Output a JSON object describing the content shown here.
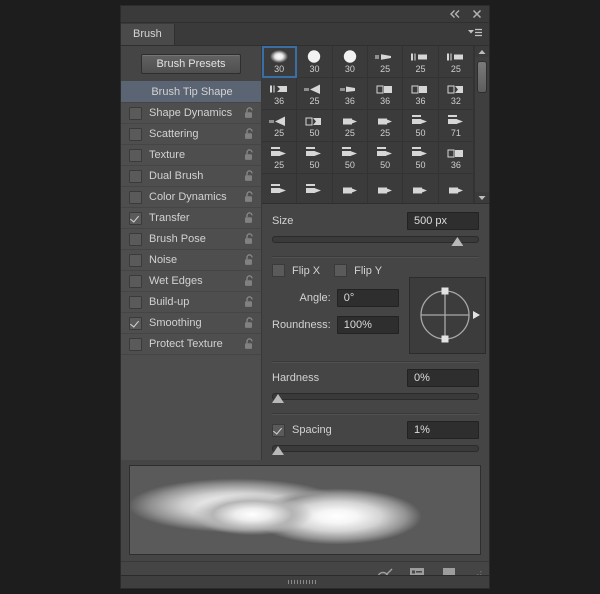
{
  "window": {
    "collapse_icon": "collapse-double-chevron-icon",
    "close_icon": "close-icon",
    "menu_icon": "panel-menu-icon"
  },
  "tabs": [
    {
      "label": "Brush",
      "active": true
    }
  ],
  "sidebar": {
    "presets_button": "Brush Presets",
    "items": [
      {
        "label": "Brush Tip Shape",
        "header": true,
        "checked": false,
        "locked": false
      },
      {
        "label": "Shape Dynamics",
        "header": false,
        "checked": false,
        "locked": true
      },
      {
        "label": "Scattering",
        "header": false,
        "checked": false,
        "locked": true
      },
      {
        "label": "Texture",
        "header": false,
        "checked": false,
        "locked": true
      },
      {
        "label": "Dual Brush",
        "header": false,
        "checked": false,
        "locked": true
      },
      {
        "label": "Color Dynamics",
        "header": false,
        "checked": false,
        "locked": true
      },
      {
        "label": "Transfer",
        "header": false,
        "checked": true,
        "locked": true
      },
      {
        "label": "Brush Pose",
        "header": false,
        "checked": false,
        "locked": true
      },
      {
        "label": "Noise",
        "header": false,
        "checked": false,
        "locked": true
      },
      {
        "label": "Wet Edges",
        "header": false,
        "checked": false,
        "locked": true
      },
      {
        "label": "Build-up",
        "header": false,
        "checked": false,
        "locked": true
      },
      {
        "label": "Smoothing",
        "header": false,
        "checked": true,
        "locked": true
      },
      {
        "label": "Protect Texture",
        "header": false,
        "checked": false,
        "locked": true
      }
    ]
  },
  "brush_grid": {
    "selected_index": 0,
    "scroll_up_icon": "scroll-up-arrow-icon",
    "scroll_down_icon": "scroll-down-arrow-icon",
    "cells": [
      {
        "size": "30",
        "tip": "soft-round"
      },
      {
        "size": "30",
        "tip": "hard-round"
      },
      {
        "size": "30",
        "tip": "hard-round"
      },
      {
        "size": "25",
        "tip": "flat-tip"
      },
      {
        "size": "25",
        "tip": "bristle-flat"
      },
      {
        "size": "25",
        "tip": "bristle-flat"
      },
      {
        "size": "36",
        "tip": "bristle-angle"
      },
      {
        "size": "25",
        "tip": "fan"
      },
      {
        "size": "36",
        "tip": "chisel"
      },
      {
        "size": "36",
        "tip": "square-flat"
      },
      {
        "size": "36",
        "tip": "square-flat"
      },
      {
        "size": "32",
        "tip": "angled-flat"
      },
      {
        "size": "25",
        "tip": "fan"
      },
      {
        "size": "50",
        "tip": "angled-flat"
      },
      {
        "size": "25",
        "tip": "wedge"
      },
      {
        "size": "25",
        "tip": "wedge"
      },
      {
        "size": "50",
        "tip": "pencil"
      },
      {
        "size": "71",
        "tip": "pencil"
      },
      {
        "size": "25",
        "tip": "pencil"
      },
      {
        "size": "50",
        "tip": "pencil"
      },
      {
        "size": "50",
        "tip": "pencil"
      },
      {
        "size": "50",
        "tip": "pencil"
      },
      {
        "size": "50",
        "tip": "pencil"
      },
      {
        "size": "36",
        "tip": "square-flat"
      },
      {
        "size": "",
        "tip": "pencil"
      },
      {
        "size": "",
        "tip": "pencil"
      },
      {
        "size": "",
        "tip": "wedge"
      },
      {
        "size": "",
        "tip": "wedge"
      },
      {
        "size": "",
        "tip": "wedge"
      },
      {
        "size": "",
        "tip": "wedge"
      }
    ]
  },
  "controls": {
    "size": {
      "label": "Size",
      "value": "500 px",
      "slider_percent": 92
    },
    "flip_x": {
      "label": "Flip X",
      "checked": false
    },
    "flip_y": {
      "label": "Flip Y",
      "checked": false
    },
    "angle": {
      "label": "Angle:",
      "value": "0°"
    },
    "roundness": {
      "label": "Roundness:",
      "value": "100%"
    },
    "hardness": {
      "label": "Hardness",
      "value": "0%",
      "slider_percent": 0
    },
    "spacing": {
      "label": "Spacing",
      "value": "1%",
      "checked": true,
      "slider_percent": 0
    },
    "dial_name": "angle-roundness-dial"
  },
  "footer": {
    "toggle_icon": "brush-toggle-icon",
    "preset_manager_icon": "preset-manager-icon",
    "new_brush_icon": "new-brush-icon",
    "resize_grip_icon": "resize-grip-icon"
  },
  "dock": {
    "grip_icon": "dock-grip-icon"
  },
  "colors": {
    "panel_bg": "#454545",
    "sidebar_bg": "#4e4e4e",
    "header_blue": "#5a6472",
    "selection_blue": "#3b6ea5",
    "grid_bg": "#3b3b3b",
    "field_bg": "#2e2e2e"
  }
}
